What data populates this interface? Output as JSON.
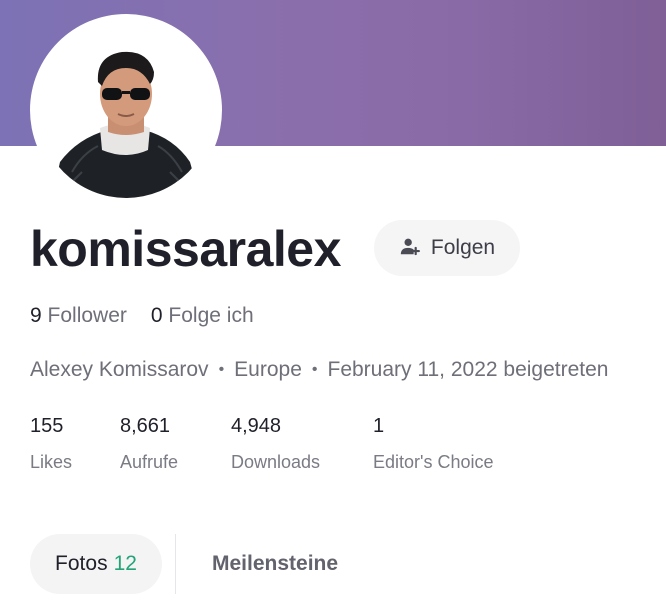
{
  "profile": {
    "username": "komissaralex",
    "follow_button_label": "Folgen",
    "followers_count": "9",
    "followers_label": "Follower",
    "following_count": "0",
    "following_label": "Folge ich",
    "full_name": "Alexey Komissarov",
    "location": "Europe",
    "joined": "February 11, 2022 beigetreten",
    "separator": "•"
  },
  "stats": [
    {
      "value": "155",
      "label": "Likes"
    },
    {
      "value": "8,661",
      "label": "Aufrufe"
    },
    {
      "value": "4,948",
      "label": "Downloads"
    },
    {
      "value": "1",
      "label": "Editor's Choice"
    }
  ],
  "tabs": [
    {
      "label": "Fotos",
      "count": "12",
      "active": true
    },
    {
      "label": "Meilensteine",
      "active": false
    }
  ],
  "colors": {
    "cover_gradient": [
      "#7c72b5",
      "#8a6aa6",
      "#7f5f96"
    ],
    "accent_count": "#24a37a"
  },
  "icons": {
    "follow": "add-user-icon"
  }
}
